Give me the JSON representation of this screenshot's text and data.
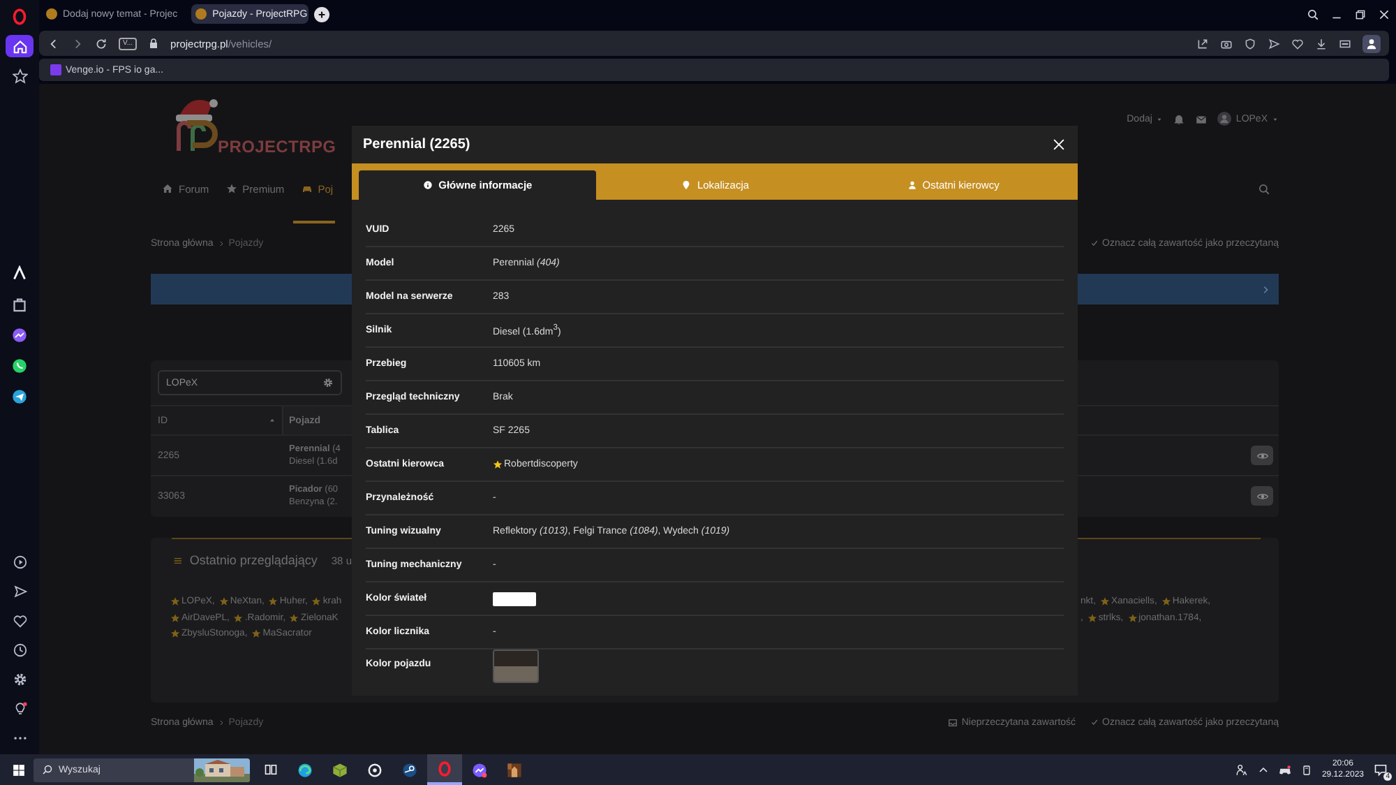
{
  "browser": {
    "tabs": [
      {
        "title": "Dodaj nowy temat - Projec",
        "selected": false
      },
      {
        "title": "Pojazdy - ProjectRPG",
        "selected": true
      }
    ],
    "address": {
      "badge": "V...",
      "host": "projectrpg.pl",
      "path": "/vehicles/"
    },
    "bookmarks": [
      {
        "title": "Venge.io - FPS io ga..."
      }
    ]
  },
  "sidebar": [
    {
      "kind": "home",
      "selected": true
    },
    {
      "kind": "speed-dial",
      "selected": false
    }
  ],
  "site": {
    "logo": "PROJECTRPG",
    "nav": [
      {
        "label": "Forum",
        "kind": "home",
        "selected": false
      },
      {
        "label": "Premium",
        "kind": "star",
        "selected": false
      },
      {
        "label": "Poj",
        "kind": "car",
        "selected": true
      }
    ],
    "header_actions": {
      "add": "Dodaj",
      "user": "LOPeX"
    },
    "breadcrumb": [
      "Strona główna",
      "Pojazdy"
    ],
    "mark_read": "Oznacz całą zawartość jako przeczytaną",
    "search": {
      "value": "LOPeX"
    },
    "table": {
      "columns": [
        "ID",
        "Pojazd"
      ],
      "rows": [
        {
          "id": "2265",
          "vehicle": "**Perennial** (4",
          "engine": "Diesel (1.6d"
        },
        {
          "id": "33063",
          "vehicle": "**Picador** (60",
          "engine": "Benzyna (2."
        }
      ]
    },
    "viewers": {
      "title": "Ostatnio przeglądający",
      "count": "38 u",
      "left_lines": [
        [
          {
            "name": "LOPeX,",
            "star": true
          },
          {
            "name": "NeXtan,",
            "star": true
          },
          {
            "name": "Huher,",
            "star": true
          },
          {
            "name": "krah",
            "star": true
          }
        ],
        [
          {
            "name": "AirDavePL,",
            "star": true
          },
          {
            "name": ".Radomir,",
            "star": true
          },
          {
            "name": "ZielonaK",
            "star": true
          }
        ],
        [
          {
            "name": "ZbysluStonoga,",
            "star": true
          },
          {
            "name": "MaSacrator",
            "star": true
          }
        ]
      ],
      "right_lines": [
        [
          {
            "name": "nkt,",
            "star": false
          },
          {
            "name": "Xanaciells,",
            "star": true
          },
          {
            "name": "Hakerek,",
            "star": true
          }
        ],
        [
          {
            "name": ",",
            "star": false
          },
          {
            "name": "strlks,",
            "star": true
          },
          {
            "name": "jonathan.1784,",
            "star": true
          }
        ]
      ]
    },
    "footer": {
      "breadcrumb": [
        "Strona główna",
        "Pojazdy"
      ],
      "unread": "Nieprzeczytana zawartość",
      "mark_read": "Oznacz całą zawartość jako przeczytaną"
    }
  },
  "modal": {
    "title": "Perennial (2265)",
    "tabs": [
      {
        "label": "Główne informacje",
        "kind": "info",
        "selected": true
      },
      {
        "label": "Lokalizacja",
        "kind": "pin",
        "selected": false
      },
      {
        "label": "Ostatni kierowcy",
        "kind": "user",
        "selected": false
      }
    ],
    "rows": [
      {
        "label": "VUID",
        "kind": "text",
        "value": "2265"
      },
      {
        "label": "Model",
        "kind": "text",
        "value": "Perennial *(404)*"
      },
      {
        "label": "Model na serwerze",
        "kind": "text",
        "value": "283"
      },
      {
        "label": "Silnik",
        "kind": "text",
        "value": "Diesel (1.6dm$^{3}$)"
      },
      {
        "label": "Przebieg",
        "kind": "text",
        "value": "110605 km"
      },
      {
        "label": "Przegląd techniczny",
        "kind": "text",
        "value": "Brak"
      },
      {
        "label": "Tablica",
        "kind": "text",
        "value": "SF 2265"
      },
      {
        "label": "Ostatni kierowca",
        "kind": "driver",
        "value": "Robertdiscoperty"
      },
      {
        "label": "Przynależność",
        "kind": "text",
        "value": "-"
      },
      {
        "label": "Tuning wizualny",
        "kind": "text",
        "value": "Reflektory *(1013)*, Felgi Trance *(1084)*, Wydech *(1019)*"
      },
      {
        "label": "Tuning mechaniczny",
        "kind": "text",
        "value": "-"
      },
      {
        "label": "Kolor świateł",
        "kind": "swatch",
        "swatches": [
          {
            "color": "#ffffff"
          }
        ]
      },
      {
        "label": "Kolor licznika",
        "kind": "text",
        "value": "-"
      },
      {
        "label": "Kolor pojazdu",
        "kind": "swatch",
        "swatches": [
          {
            "color": "#2b2622"
          },
          {
            "color": "#6e655b"
          }
        ]
      }
    ]
  },
  "taskbar": {
    "search_placeholder": "Wyszukaj",
    "apps": [
      {
        "kind": "task-view",
        "selected": false
      },
      {
        "kind": "edge",
        "selected": false
      },
      {
        "kind": "cube",
        "selected": false
      },
      {
        "kind": "lens",
        "selected": false
      },
      {
        "kind": "steam",
        "selected": false
      },
      {
        "kind": "opera",
        "selected": true
      },
      {
        "kind": "messenger",
        "selected": false
      },
      {
        "kind": "game",
        "selected": false
      }
    ],
    "time": "20:06",
    "date": "29.12.2023",
    "notifications": "4"
  }
}
